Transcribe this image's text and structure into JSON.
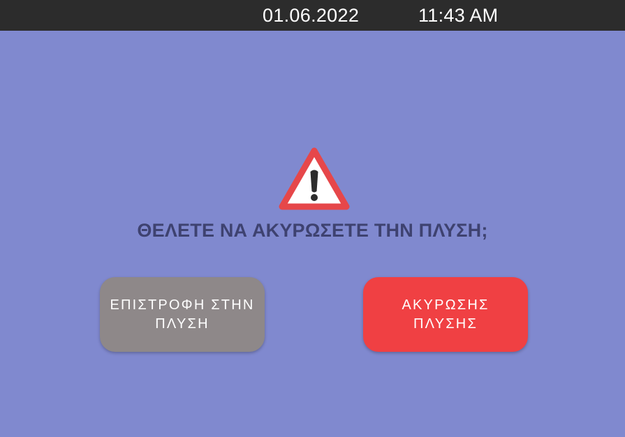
{
  "status_bar": {
    "date": "01.06.2022",
    "time": "11:43 AM"
  },
  "dialog": {
    "icon": "warning-icon",
    "question": "ΘΕΛΕΤΕ ΝΑ ΑΚΥΡΩΣΕΤΕ ΤΗΝ ΠΛΥΣΗ;",
    "return_button": {
      "line1": "ΕΠΙΣΤΡΟΦΗ ΣΤΗΝ",
      "line2": "ΠΛΥΣΗ"
    },
    "cancel_button": {
      "line1": "ΑΚΥΡΩΣΗΣ",
      "line2": "ΠΛΥΣΗΣ"
    }
  },
  "colors": {
    "background": "#8089cf",
    "status_bar": "#2c2c2c",
    "question_text": "#3e4270",
    "return_button": "#8e8889",
    "cancel_button": "#f04043",
    "warning_border": "#e6474a"
  }
}
